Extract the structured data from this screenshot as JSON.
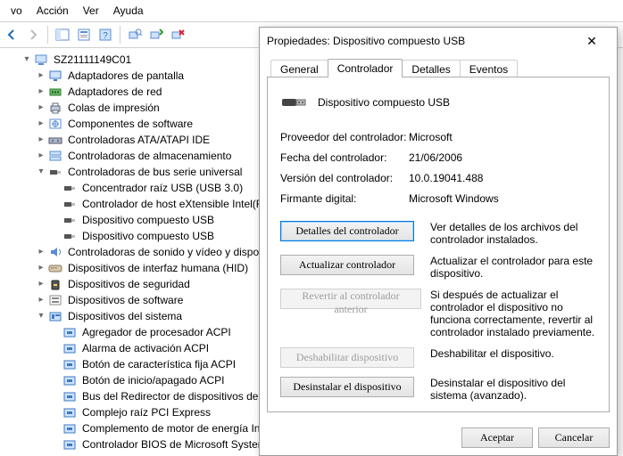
{
  "menu": {
    "items": [
      "vo",
      "Acción",
      "Ver",
      "Ayuda"
    ]
  },
  "tree": {
    "root": "SZ21111149C01",
    "nodes": [
      {
        "label": "Adaptadores de pantalla",
        "icon": "monitor",
        "tw": "right"
      },
      {
        "label": "Adaptadores de red",
        "icon": "nic",
        "tw": "right"
      },
      {
        "label": "Colas de impresión",
        "icon": "printer",
        "tw": "right"
      },
      {
        "label": "Componentes de software",
        "icon": "sw",
        "tw": "right"
      },
      {
        "label": "Controladoras ATA/ATAPI IDE",
        "icon": "ide",
        "tw": "right"
      },
      {
        "label": "Controladoras de almacenamiento",
        "icon": "storage",
        "tw": "right"
      },
      {
        "label": "Controladoras de bus serie universal",
        "icon": "usb-ctrl",
        "tw": "down"
      },
      {
        "label": "Concentrador raíz USB (USB 3.0)",
        "icon": "usb",
        "child": true
      },
      {
        "label": "Controlador de host eXtensible Intel(R) USB",
        "icon": "usb",
        "child": true
      },
      {
        "label": "Dispositivo compuesto USB",
        "icon": "usb",
        "child": true
      },
      {
        "label": "Dispositivo compuesto USB",
        "icon": "usb",
        "child": true
      },
      {
        "label": "Controladoras de sonido y vídeo y dispositivos",
        "icon": "sound",
        "tw": "right"
      },
      {
        "label": "Dispositivos de interfaz humana (HID)",
        "icon": "hid",
        "tw": "right"
      },
      {
        "label": "Dispositivos de seguridad",
        "icon": "security",
        "tw": "right"
      },
      {
        "label": "Dispositivos de software",
        "icon": "sw2",
        "tw": "right"
      },
      {
        "label": "Dispositivos del sistema",
        "icon": "system",
        "tw": "down"
      },
      {
        "label": "Agregador de procesador ACPI",
        "icon": "sys",
        "child": true
      },
      {
        "label": "Alarma de activación ACPI",
        "icon": "sys",
        "child": true
      },
      {
        "label": "Botón de característica fija ACPI",
        "icon": "sys",
        "child": true
      },
      {
        "label": "Botón de inicio/apagado ACPI",
        "icon": "sys",
        "child": true
      },
      {
        "label": "Bus del Redirector de dispositivos de Escrito",
        "icon": "sys",
        "child": true
      },
      {
        "label": "Complejo raíz PCI Express",
        "icon": "sys",
        "child": true
      },
      {
        "label": "Complemento de motor de energía Intel(R)",
        "icon": "sys",
        "child": true
      },
      {
        "label": "Controlador BIOS de Microsoft System Management",
        "icon": "sys",
        "child": true
      }
    ]
  },
  "dialog": {
    "title": "Propiedades: Dispositivo compuesto USB",
    "tabs": [
      "General",
      "Controlador",
      "Detalles",
      "Eventos"
    ],
    "active_tab": 1,
    "device_name": "Dispositivo compuesto USB",
    "kv": [
      {
        "k": "Proveedor del controlador:",
        "v": "Microsoft"
      },
      {
        "k": "Fecha del controlador:",
        "v": "21/06/2006"
      },
      {
        "k": "Versión del controlador:",
        "v": "10.0.19041.488"
      },
      {
        "k": "Firmante digital:",
        "v": "Microsoft Windows"
      }
    ],
    "actions": [
      {
        "btn": "Detalles del controlador",
        "desc": "Ver detalles de los archivos del controlador instalados.",
        "enabled": true,
        "focus": true
      },
      {
        "btn": "Actualizar controlador",
        "desc": "Actualizar el controlador para este dispositivo.",
        "enabled": true
      },
      {
        "btn": "Revertir al controlador anterior",
        "desc": "Si después de actualizar el controlador el dispositivo no funciona correctamente, revertir al controlador instalado previamente.",
        "enabled": false
      },
      {
        "btn": "Deshabilitar dispositivo",
        "desc": "Deshabilitar el dispositivo.",
        "enabled": false
      },
      {
        "btn": "Desinstalar el dispositivo",
        "desc": "Desinstalar el dispositivo del sistema (avanzado).",
        "enabled": true
      }
    ],
    "ok": "Aceptar",
    "cancel": "Cancelar"
  }
}
